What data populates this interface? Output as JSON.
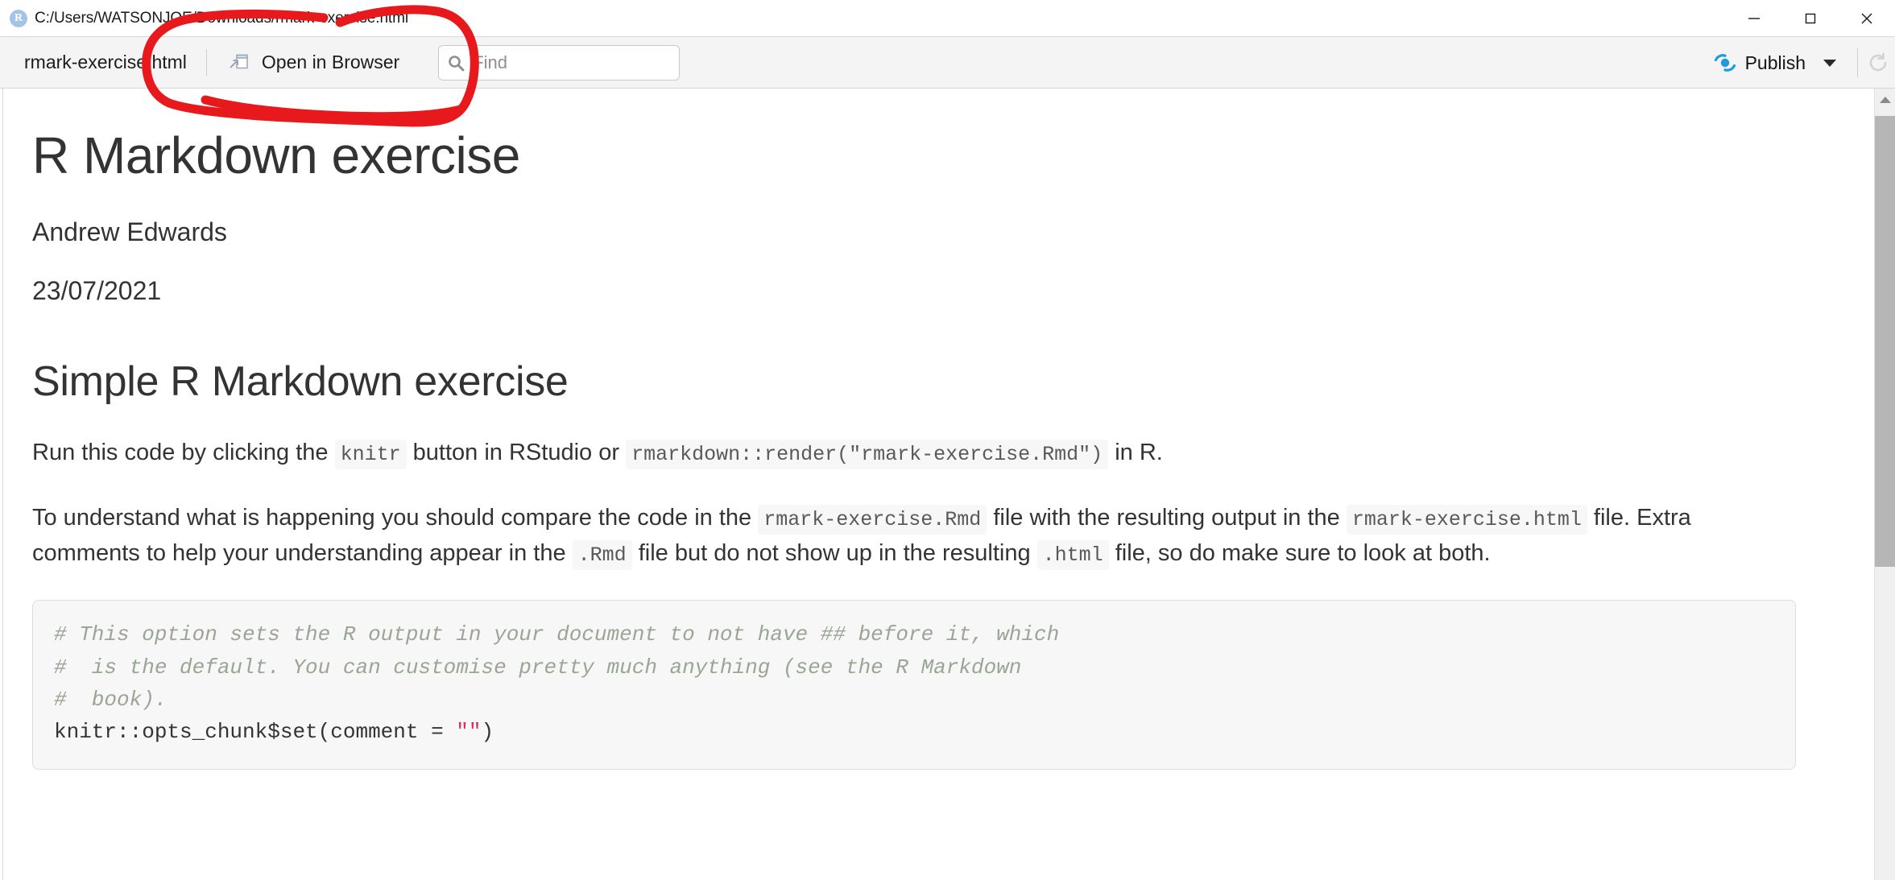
{
  "window": {
    "app_icon": "r-logo-icon",
    "title_path": "C:/Users/WATSONJOE/Downloads/rmark-exercise.html",
    "controls": {
      "minimize": "minimize-icon",
      "maximize": "maximize-icon",
      "close": "close-icon"
    }
  },
  "toolbar": {
    "filename": "rmark-exercise.html",
    "open_in_browser_label": "Open in Browser",
    "open_in_browser_icon": "open-in-browser-icon",
    "find": {
      "icon": "search-icon",
      "placeholder": "Find",
      "value": ""
    },
    "publish_label": "Publish",
    "publish_icon": "publish-icon",
    "publish_caret": "chevron-down-icon",
    "refresh_icon": "refresh-icon"
  },
  "annotation": {
    "type": "hand-drawn-circle",
    "color": "#e8191c",
    "target": "Open in Browser"
  },
  "document": {
    "title": "R Markdown exercise",
    "author": "Andrew Edwards",
    "date": "23/07/2021",
    "section_title": "Simple R Markdown exercise",
    "paragraph1": {
      "part1": "Run this code by clicking the ",
      "code1": "knitr",
      "part2": " button in RStudio or ",
      "code2": "rmarkdown::render(\"rmark-exercise.Rmd\")",
      "part3": " in R."
    },
    "paragraph2": {
      "part1": "To understand what is happening you should compare the code in the ",
      "code1": "rmark-exercise.Rmd",
      "part2": " file with the resulting output in the ",
      "code2": "rmark-exercise.html",
      "part3": " file. Extra comments to help your understanding appear in the ",
      "code3": ".Rmd",
      "part4": " file but do not show up in the resulting ",
      "code4": ".html",
      "part5": " file, so do make sure to look at both."
    },
    "code_block": {
      "comment_line1": "# This option sets the R output in your document to not have ## before it, which",
      "comment_line2": "#  is the default. You can customise pretty much anything (see the R Markdown",
      "comment_line3": "#  book).",
      "code_line_prefix": "knitr::opts_chunk$set(comment = ",
      "code_line_string": "\"\"",
      "code_line_suffix": ")"
    }
  },
  "scrollbar": {
    "up_arrow": "scroll-up-icon",
    "position": "top"
  },
  "colors": {
    "accent_blue": "#1f9bdd",
    "annotation_red": "#e8191c",
    "toolbar_bg": "#f4f4f4",
    "code_bg": "#f7f7f7",
    "text": "#333333",
    "comment": "#9aa596",
    "string": "#d1335b"
  }
}
